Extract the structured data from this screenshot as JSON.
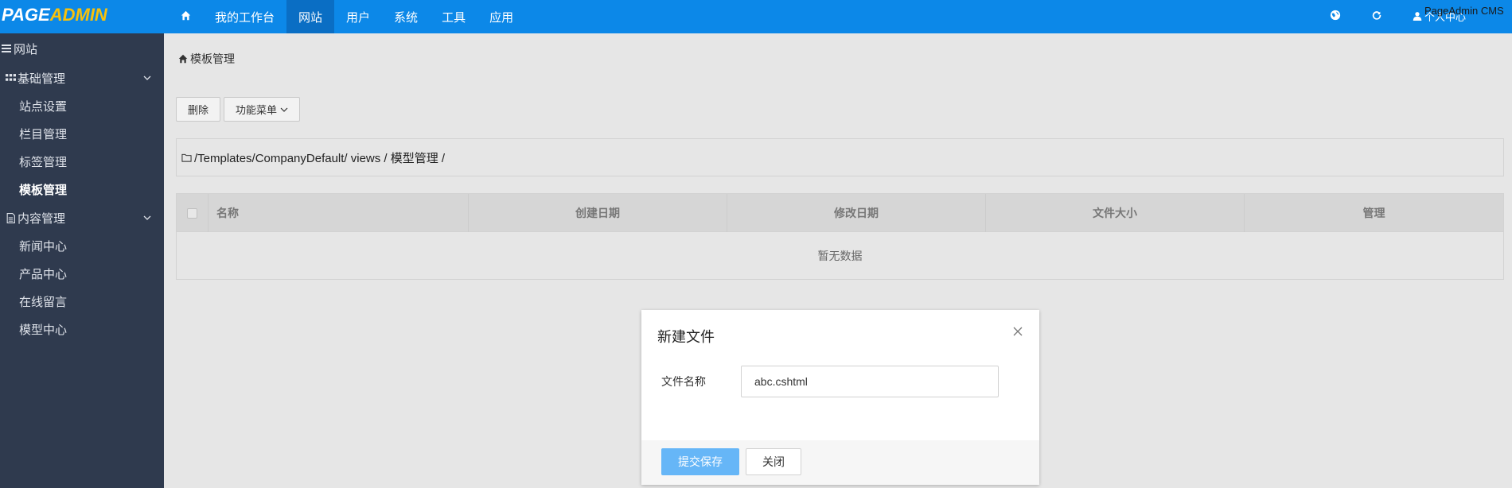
{
  "logo": {
    "part1": "PAGE",
    "part2": "ADMIN"
  },
  "topnav": {
    "home_icon": "home-icon",
    "items": [
      {
        "label": "我的工作台"
      },
      {
        "label": "网站"
      },
      {
        "label": "用户"
      },
      {
        "label": "系统"
      },
      {
        "label": "工具"
      },
      {
        "label": "应用"
      }
    ],
    "active": "网站"
  },
  "topright": {
    "icons": [
      "globe-icon",
      "refresh-icon",
      "user-icon"
    ],
    "user_text": "个人中心",
    "brand_text": "PageAdmin CMS"
  },
  "sidebar": {
    "header": "网站",
    "groups": [
      {
        "label": "基础管理",
        "items": [
          {
            "label": "站点设置"
          },
          {
            "label": "栏目管理"
          },
          {
            "label": "标签管理"
          },
          {
            "label": "模板管理"
          }
        ]
      },
      {
        "label": "内容管理",
        "items": [
          {
            "label": "新闻中心"
          },
          {
            "label": "产品中心"
          },
          {
            "label": "在线留言"
          },
          {
            "label": "模型中心"
          }
        ]
      }
    ],
    "active_item": "模板管理"
  },
  "main": {
    "breadcrumb": "模板管理",
    "toolbar": {
      "delete_label": "删除",
      "func_menu_label": "功能菜单"
    },
    "path": "/Templates/CompanyDefault/ views / 模型管理 /",
    "table": {
      "columns": [
        "名称",
        "创建日期",
        "修改日期",
        "文件大小",
        "管理"
      ],
      "empty_text": "暂无数据"
    }
  },
  "modal": {
    "title": "新建文件",
    "field_label": "文件名称",
    "field_value": "abc.cshtml",
    "save_label": "提交保存",
    "close_label": "关闭"
  },
  "colors": {
    "topbar": "#0c88e8",
    "sidebar": "#2f3a4e",
    "accent_logo": "#f7c10c",
    "save_button": "#66b6f7"
  }
}
